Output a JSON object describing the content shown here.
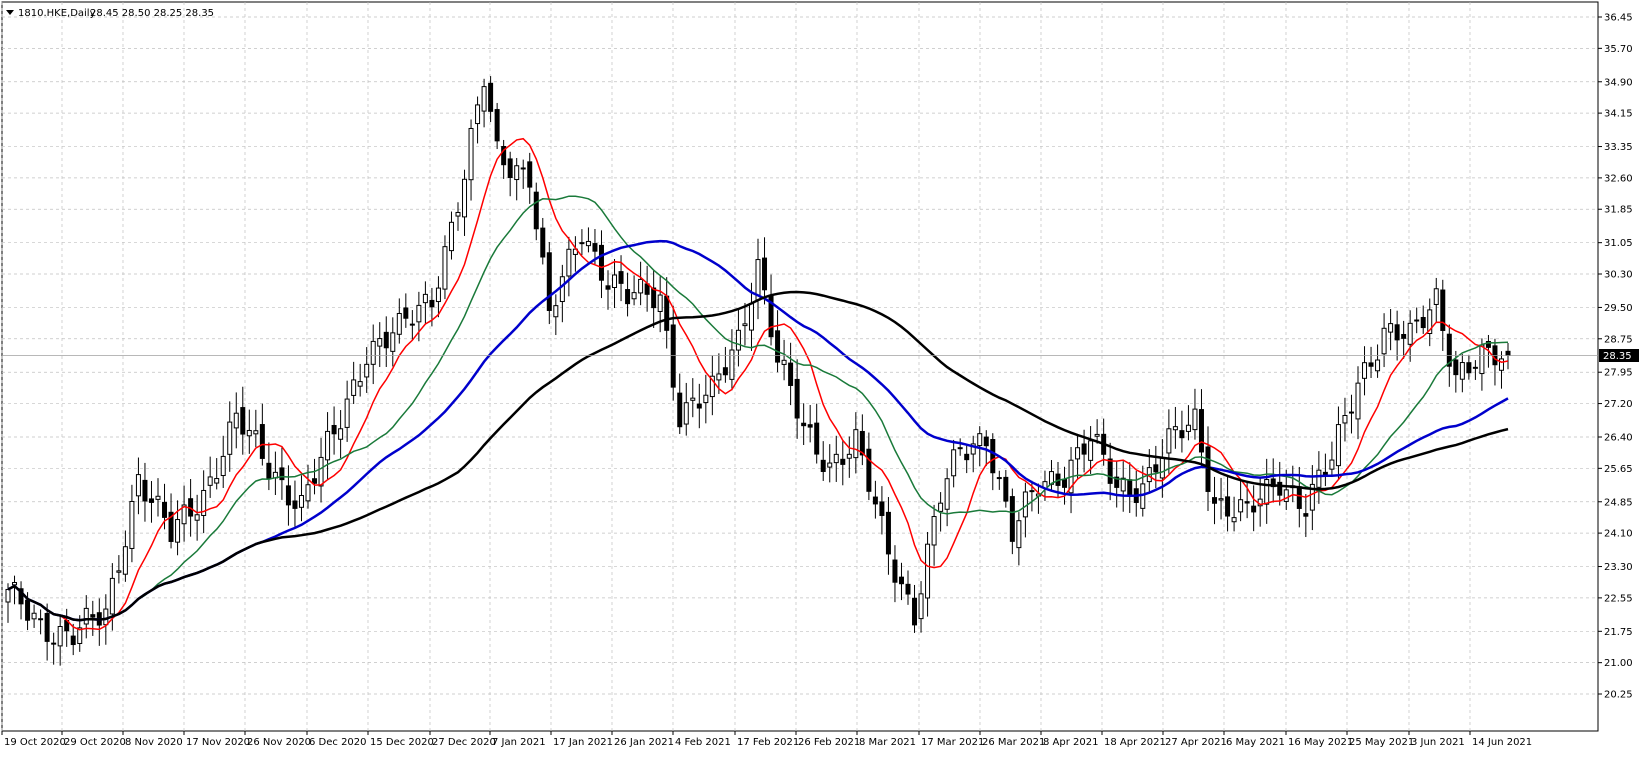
{
  "header": {
    "symbol": "1810.HKE,Daily",
    "ohlc": "28.45 28.50 28.25 28.35"
  },
  "chart_data": {
    "type": "candlestick",
    "title": "1810.HKE,Daily",
    "ylim": [
      20.25,
      36.45
    ],
    "y_ticks": [
      "36.45",
      "35.70",
      "34.90",
      "34.15",
      "33.35",
      "32.60",
      "31.85",
      "31.05",
      "30.30",
      "29.50",
      "28.75",
      "27.95",
      "27.20",
      "26.40",
      "25.65",
      "24.85",
      "24.10",
      "23.30",
      "22.55",
      "21.75",
      "21.00",
      "20.25"
    ],
    "x_ticks": [
      "19 Oct 2020",
      "29 Oct 2020",
      "8 Nov 2020",
      "17 Nov 2020",
      "26 Nov 2020",
      "6 Dec 2020",
      "15 Dec 2020",
      "27 Dec 2020",
      "7 Jan 2021",
      "17 Jan 2021",
      "26 Jan 2021",
      "4 Feb 2021",
      "17 Feb 2021",
      "26 Feb 2021",
      "8 Mar 2021",
      "17 Mar 2021",
      "26 Mar 2021",
      "8 Apr 2021",
      "18 Apr 2021",
      "27 Apr 2021",
      "6 May 2021",
      "16 May 2021",
      "25 May 2021",
      "3 Jun 2021",
      "14 Jun 2021"
    ],
    "current_price": "28.35",
    "grid": true,
    "close_anchors": [
      [
        0,
        22.6
      ],
      [
        5,
        21.9
      ],
      [
        10,
        21.7
      ],
      [
        15,
        22.1
      ],
      [
        20,
        25.5
      ],
      [
        25,
        24.0
      ],
      [
        30,
        25.1
      ],
      [
        35,
        26.8
      ],
      [
        40,
        25.7
      ],
      [
        45,
        24.8
      ],
      [
        50,
        26.4
      ],
      [
        55,
        28.5
      ],
      [
        60,
        28.9
      ],
      [
        65,
        29.8
      ],
      [
        70,
        32.6
      ],
      [
        73,
        34.9
      ],
      [
        75,
        33.2
      ],
      [
        80,
        32.7
      ],
      [
        83,
        29.2
      ],
      [
        88,
        31.4
      ],
      [
        92,
        30.2
      ],
      [
        95,
        29.7
      ],
      [
        100,
        29.8
      ],
      [
        103,
        27.0
      ],
      [
        108,
        27.4
      ],
      [
        112,
        28.8
      ],
      [
        115,
        30.6
      ],
      [
        118,
        28.2
      ],
      [
        122,
        26.6
      ],
      [
        126,
        25.8
      ],
      [
        130,
        26.2
      ],
      [
        135,
        23.7
      ],
      [
        139,
        22.2
      ],
      [
        143,
        24.9
      ],
      [
        146,
        26.1
      ],
      [
        150,
        26.5
      ],
      [
        154,
        24.0
      ],
      [
        158,
        25.3
      ],
      [
        162,
        25.6
      ],
      [
        166,
        26.3
      ],
      [
        170,
        25.2
      ],
      [
        174,
        25.3
      ],
      [
        178,
        26.2
      ],
      [
        182,
        26.8
      ],
      [
        185,
        24.9
      ],
      [
        190,
        24.5
      ],
      [
        195,
        25.4
      ],
      [
        199,
        24.8
      ],
      [
        203,
        25.8
      ],
      [
        207,
        27.8
      ],
      [
        211,
        28.9
      ],
      [
        215,
        28.7
      ],
      [
        219,
        29.8
      ],
      [
        222,
        27.9
      ],
      [
        226,
        28.2
      ],
      [
        230,
        28.35
      ]
    ],
    "series": [
      {
        "name": "",
        "color": "#ff0000",
        "period": 9,
        "width": 1.5
      },
      {
        "name": "",
        "color": "#1a7a3a",
        "period": 20,
        "width": 1.5
      },
      {
        "name": "",
        "color": "#0000cc",
        "period": 40,
        "width": 2.5
      },
      {
        "name": "",
        "color": "#000000",
        "period": 70,
        "width": 2.5
      }
    ],
    "colors": {
      "bull": "#ffffff",
      "bear": "#000000",
      "wick": "#000000",
      "grid": "#c0c0c0",
      "price_tag_bg": "#000000",
      "price_tag_fg": "#ffffff"
    }
  }
}
